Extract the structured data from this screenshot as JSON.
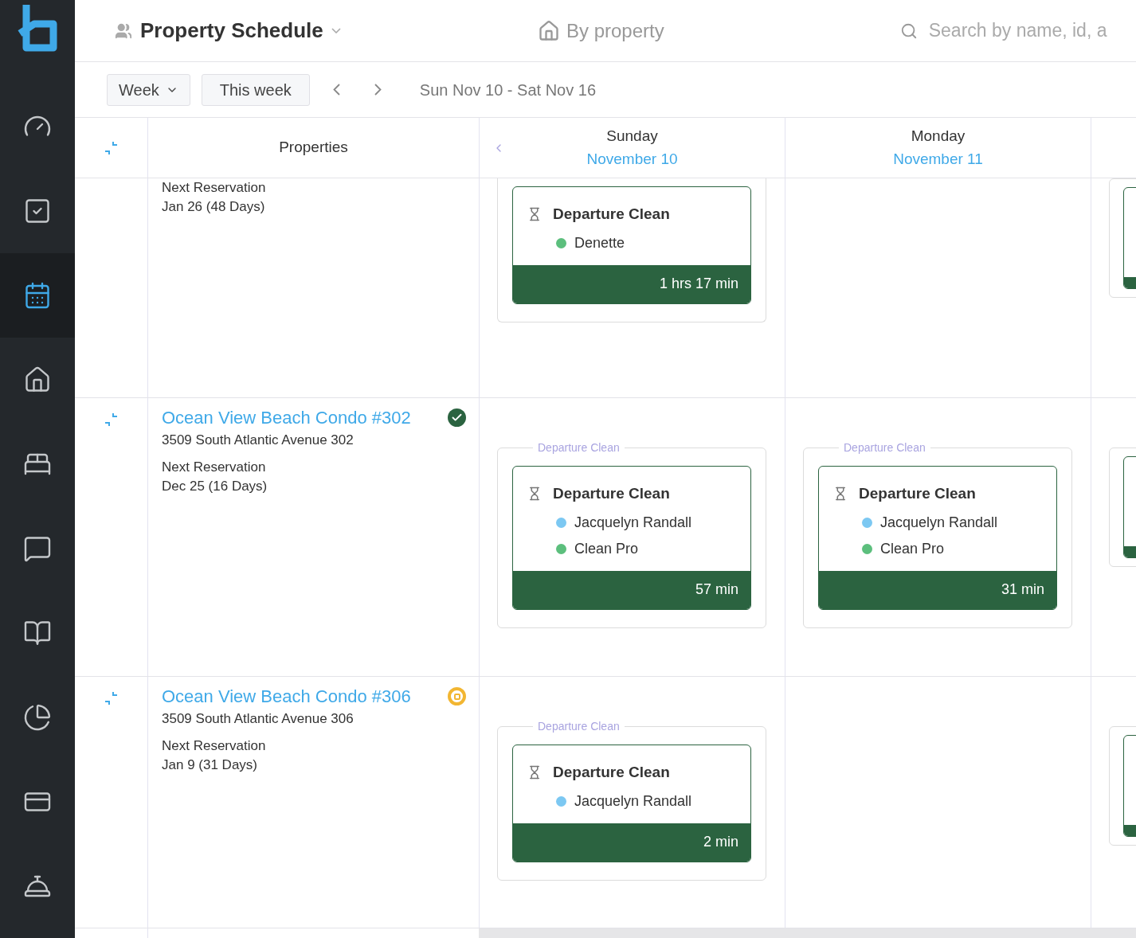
{
  "sidebar": {
    "items": [
      {
        "kind": "dashboard",
        "selected": false
      },
      {
        "kind": "tasks",
        "selected": false
      },
      {
        "kind": "calendar",
        "selected": true
      },
      {
        "kind": "home",
        "selected": false
      },
      {
        "kind": "bed",
        "selected": false
      },
      {
        "kind": "messages",
        "selected": false
      },
      {
        "kind": "guide",
        "selected": false
      },
      {
        "kind": "reports",
        "selected": false
      },
      {
        "kind": "billing",
        "selected": false
      },
      {
        "kind": "concierge",
        "selected": false
      }
    ]
  },
  "header": {
    "title": "Property Schedule",
    "view": "By property",
    "search": {
      "placeholder": "Search by name, id, a"
    }
  },
  "toolbar": {
    "period": "Week",
    "today_button": "This week",
    "range": "Sun Nov 10 - Sat Nov 16"
  },
  "columns": {
    "properties": "Properties",
    "days": [
      {
        "weekday": "Sunday",
        "date": "November 10"
      },
      {
        "weekday": "Monday",
        "date": "November 11"
      }
    ]
  },
  "rows": [
    {
      "property": {
        "next_label": "Next Reservation",
        "next_date": "Jan 26 (48 Days)"
      },
      "cells": [
        [
          {
            "kind": "full",
            "title": "Departure Clean",
            "assignees": [
              {
                "name": "Denette",
                "color": "#5cbf7d"
              }
            ],
            "duration": "1 hrs 17 min"
          }
        ],
        [],
        [
          {
            "kind": "clipped"
          }
        ]
      ]
    },
    {
      "property": {
        "name": "Ocean View Beach Condo #302",
        "address": "3509 South Atlantic Avenue 302",
        "done": true,
        "next_label": "Next Reservation",
        "next_date": "Dec 25 (16 Days)"
      },
      "cells": [
        [
          {
            "kind": "full",
            "group_label": "Departure Clean",
            "title": "Departure Clean",
            "assignees": [
              {
                "name": "Jacquelyn Randall",
                "color": "#7cc8f2"
              },
              {
                "name": "Clean Pro",
                "color": "#5cbf7d"
              }
            ],
            "duration": "57 min"
          }
        ],
        [
          {
            "kind": "full",
            "group_label": "Departure Clean",
            "title": "Departure Clean",
            "assignees": [
              {
                "name": "Jacquelyn Randall",
                "color": "#7cc8f2"
              },
              {
                "name": "Clean Pro",
                "color": "#5cbf7d"
              }
            ],
            "duration": "31 min"
          }
        ],
        [
          {
            "kind": "clipped"
          }
        ]
      ]
    },
    {
      "property": {
        "name": "Ocean View Beach Condo #306",
        "address": "3509 South Atlantic Avenue 306",
        "done": false,
        "next_label": "Next Reservation",
        "next_date": "Jan 9 (31 Days)"
      },
      "cells": [
        [
          {
            "kind": "full",
            "group_label": "Departure Clean",
            "title": "Departure Clean",
            "assignees": [
              {
                "name": "Jacquelyn Randall",
                "color": "#7cc8f2"
              }
            ],
            "duration": "2 min"
          }
        ],
        [],
        [
          {
            "kind": "clipped"
          }
        ]
      ]
    }
  ]
}
